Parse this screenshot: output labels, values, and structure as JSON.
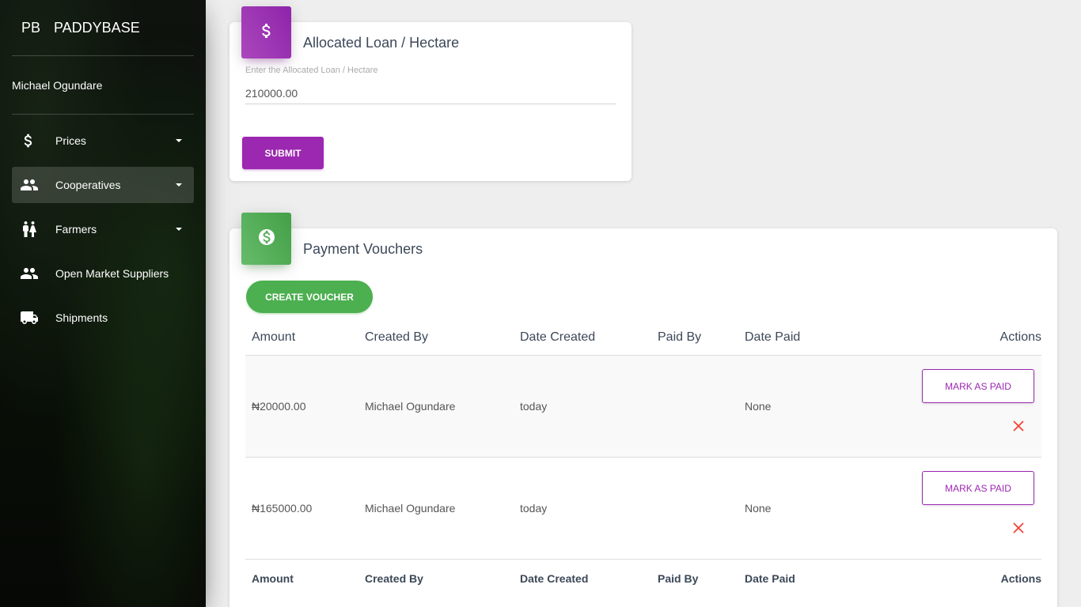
{
  "sidebar": {
    "logo_mini": "PB",
    "logo_text": "PADDYBASE",
    "user_name": "Michael Ogundare",
    "items": [
      {
        "label": "Prices",
        "icon": "dollar-icon",
        "has_caret": true
      },
      {
        "label": "Cooperatives",
        "icon": "people-icon",
        "has_caret": true,
        "active": true
      },
      {
        "label": "Farmers",
        "icon": "wc-icon",
        "has_caret": true
      },
      {
        "label": "Open Market Suppliers",
        "icon": "people-icon",
        "has_caret": false
      },
      {
        "label": "Shipments",
        "icon": "van-icon",
        "has_caret": false
      }
    ]
  },
  "loan_card": {
    "icon": "dollar-icon",
    "title": "Allocated Loan / Hectare",
    "input_label": "Enter the Allocated Loan / Hectare",
    "input_value": "210000.00",
    "submit_label": "SUBMIT"
  },
  "voucher_card": {
    "icon": "monetization-icon",
    "title": "Payment Vouchers",
    "create_label": "CREATE VOUCHER",
    "columns": [
      "Amount",
      "Created By",
      "Date Created",
      "Paid By",
      "Date Paid",
      "Actions"
    ],
    "rows": [
      {
        "amount": "₦20000.00",
        "created_by": "Michael Ogundare",
        "date_created": "today",
        "paid_by": "",
        "date_paid": "None",
        "action_label": "MARK AS PAID"
      },
      {
        "amount": "₦165000.00",
        "created_by": "Michael Ogundare",
        "date_created": "today",
        "paid_by": "",
        "date_paid": "None",
        "action_label": "MARK AS PAID"
      }
    ]
  },
  "colors": {
    "primary": "#9c27b0",
    "success": "#4caf50",
    "danger": "#f44336"
  }
}
